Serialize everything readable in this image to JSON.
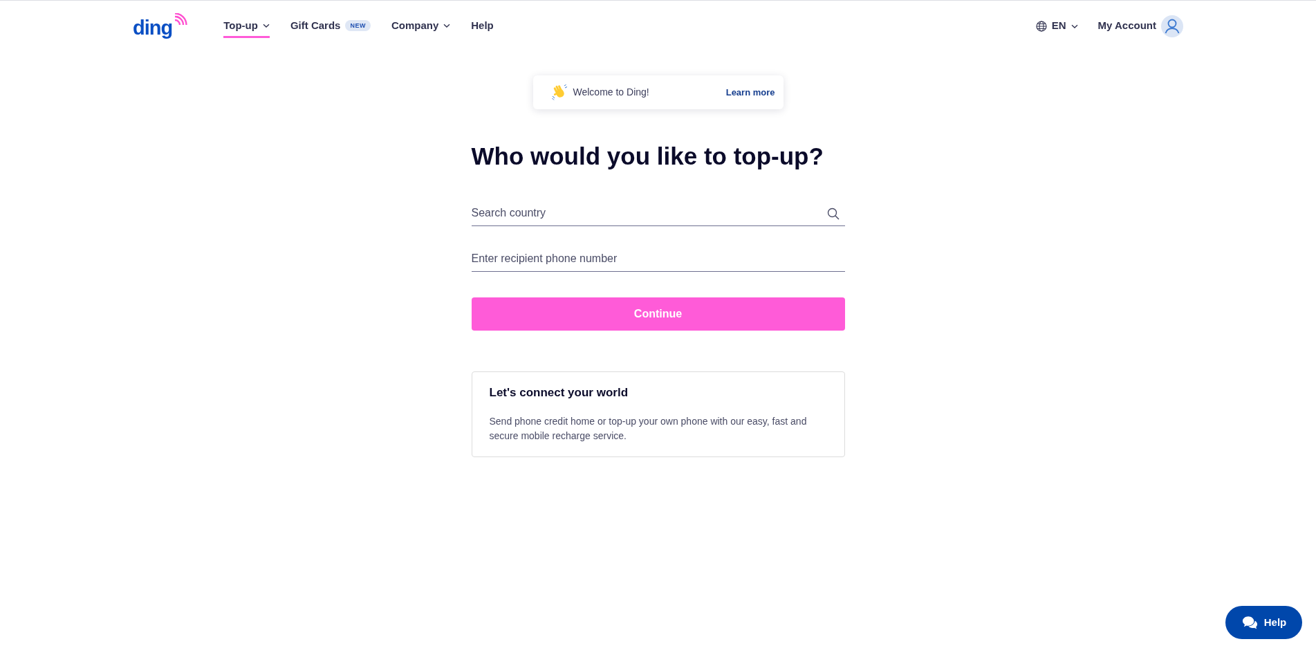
{
  "header": {
    "logo": "ding",
    "nav": [
      {
        "label": "Top-up",
        "selected": true,
        "dropdown": true
      },
      {
        "label": "Gift Cards",
        "selected": false,
        "dropdown": false,
        "badge": "NEW"
      },
      {
        "label": "Company",
        "selected": false,
        "dropdown": true
      },
      {
        "label": "Help",
        "selected": false,
        "dropdown": false
      }
    ],
    "language": "EN",
    "account": "My Account"
  },
  "notice": {
    "text": "Welcome to Ding!",
    "link": "Learn more"
  },
  "form": {
    "title": "Who would you like to top-up?",
    "fields": [
      {
        "kind": "search",
        "placeholder": "Search country"
      },
      {
        "kind": "phone",
        "placeholder": "Enter recipient phone number"
      }
    ],
    "submit": "Continue"
  },
  "info_card": {
    "title": "Let's connect your world",
    "text": "Send phone credit home or top-up your own phone with our easy, fast and secure mobile recharge service."
  },
  "help_button": "Help"
}
